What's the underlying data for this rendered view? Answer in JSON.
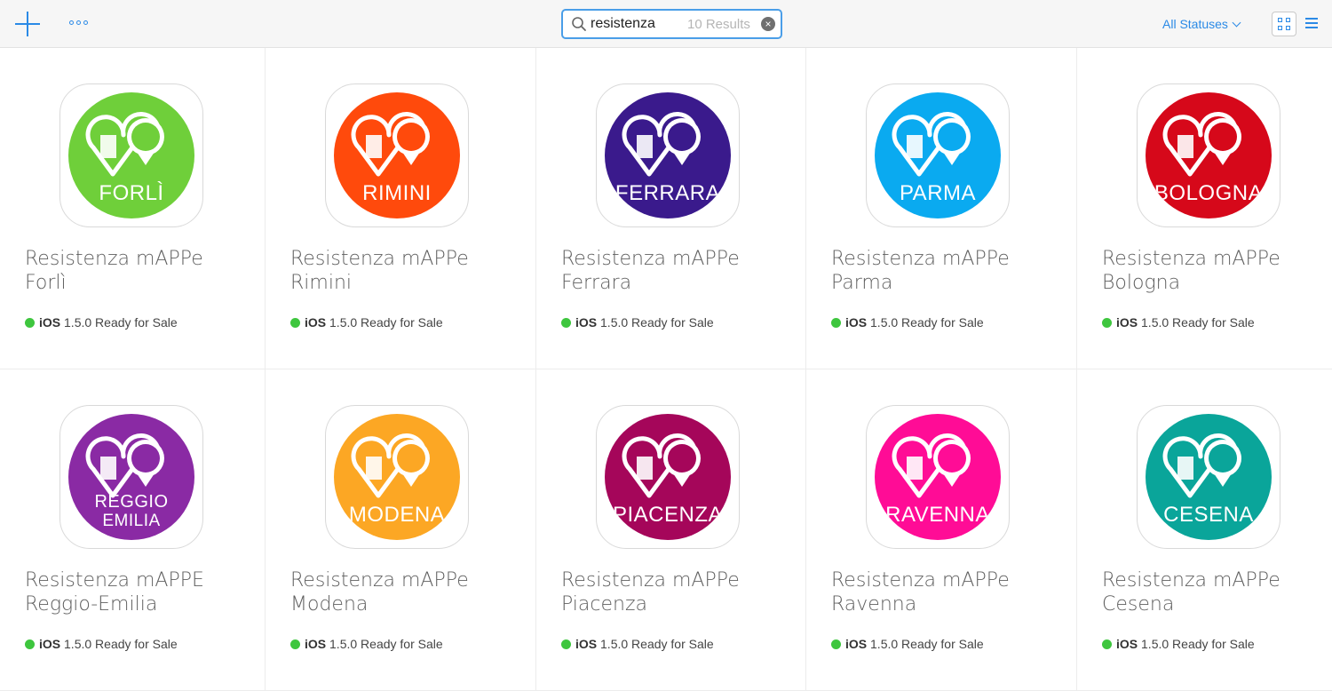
{
  "toolbar": {
    "add_icon": "plus-icon",
    "more_icon": "ellipsis-icon",
    "search": {
      "query": "resistenza",
      "results": "10 Results"
    },
    "status_filter": "All Statuses",
    "view_grid_icon": "grid-view-icon",
    "view_list_icon": "list-view-icon"
  },
  "colors": {
    "accent": "#2b8ae6",
    "status_green": "#3ec63e"
  },
  "apps": [
    {
      "name_line1": "Resistenza mAPPe",
      "name_line2": "Forlì",
      "city_label": "FORLÌ",
      "city_line2": "",
      "color": "#6fcf3a",
      "platform": "iOS",
      "version": "1.5.0",
      "status": "Ready for Sale"
    },
    {
      "name_line1": "Resistenza mAPPe",
      "name_line2": "Rimini",
      "city_label": "RIMINI",
      "city_line2": "",
      "color": "#ff4a0c",
      "platform": "iOS",
      "version": "1.5.0",
      "status": "Ready for Sale"
    },
    {
      "name_line1": "Resistenza mAPPe",
      "name_line2": "Ferrara",
      "city_label": "FERRARA",
      "city_line2": "",
      "color": "#3a1a8c",
      "platform": "iOS",
      "version": "1.5.0",
      "status": "Ready for Sale"
    },
    {
      "name_line1": "Resistenza mAPPe",
      "name_line2": "Parma",
      "city_label": "PARMA",
      "city_line2": "",
      "color": "#0aaaf0",
      "platform": "iOS",
      "version": "1.5.0",
      "status": "Ready for Sale"
    },
    {
      "name_line1": "Resistenza mAPPe",
      "name_line2": "Bologna",
      "city_label": "BOLOGNA",
      "city_line2": "",
      "color": "#d6081a",
      "platform": "iOS",
      "version": "1.5.0",
      "status": "Ready for Sale"
    },
    {
      "name_line1": "Resistenza mAPPE",
      "name_line2": "Reggio-Emilia",
      "city_label": "REGGIO",
      "city_line2": "EMILIA",
      "color": "#8a2aa4",
      "platform": "iOS",
      "version": "1.5.0",
      "status": "Ready for Sale"
    },
    {
      "name_line1": "Resistenza mAPPe",
      "name_line2": "Modena",
      "city_label": "MODENA",
      "city_line2": "",
      "color": "#fca724",
      "platform": "iOS",
      "version": "1.5.0",
      "status": "Ready for Sale"
    },
    {
      "name_line1": "Resistenza mAPPe",
      "name_line2": "Piacenza",
      "city_label": "PIACENZA",
      "city_line2": "",
      "color": "#a5065a",
      "platform": "iOS",
      "version": "1.5.0",
      "status": "Ready for Sale"
    },
    {
      "name_line1": "Resistenza mAPPe",
      "name_line2": "Ravenna",
      "city_label": "RAVENNA",
      "city_line2": "",
      "color": "#ff0c96",
      "platform": "iOS",
      "version": "1.5.0",
      "status": "Ready for Sale"
    },
    {
      "name_line1": "Resistenza mAPPe",
      "name_line2": "Cesena",
      "city_label": "CESENA",
      "city_line2": "",
      "color": "#0aa59a",
      "platform": "iOS",
      "version": "1.5.0",
      "status": "Ready for Sale"
    }
  ]
}
